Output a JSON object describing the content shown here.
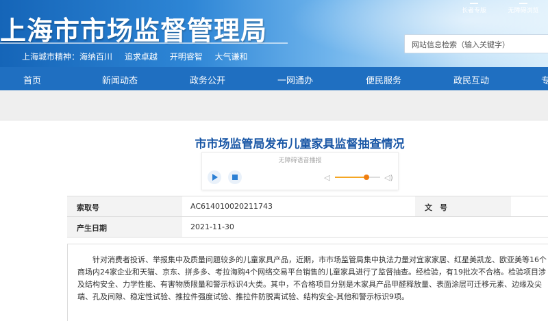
{
  "header": {
    "site_title": "上海市市场监督管理局",
    "motto": [
      "上海城市精神：海纳百川",
      "追求卓越",
      "开明睿智",
      "大气谦和"
    ],
    "tools": [
      "长者专版",
      "无障碍浏览"
    ],
    "search_placeholder": "网站信息检索（输入关键字）"
  },
  "nav": {
    "items": [
      "首页",
      "新闻动态",
      "政务公开",
      "一网通办",
      "便民服务",
      "政民互动",
      "专"
    ]
  },
  "article": {
    "title": "市市场监管局发布儿童家具监督抽查情况",
    "audio": {
      "label": "无障碍语音播报",
      "volume_level": 0.7
    },
    "info": {
      "index_label": "索取号",
      "index_value": "AC614010020211743",
      "doc_no_label": "文　号",
      "doc_no_value": "",
      "date_label": "产生日期",
      "date_value": "2021-11-30"
    },
    "body": "针对消费者投诉、举报集中及质量问题较多的儿童家具产品，近期，市市场监管局集中执法力量对宜家家居、红星美凯龙、欧亚美等16个商场内24家企业和天猫、京东、拼多多、考拉海购4个网络交易平台销售的儿童家具进行了监督抽查。经检验，有19批次不合格。检验项目涉及结构安全、力学性能、有害物质限量和警示标识4大类。其中，不合格项目分别是木家具产品甲醛释放量、表面涂层可迁移元素、边缘及尖端、孔及间隙、稳定性试验、推拉件强度试验、推拉件防脱离试验、结构安全-其他和警示标识9项。"
  },
  "colors": {
    "nav_bg": "#1f6fc1",
    "title_color": "#1a57a6",
    "accent_orange": "#f07e10"
  }
}
